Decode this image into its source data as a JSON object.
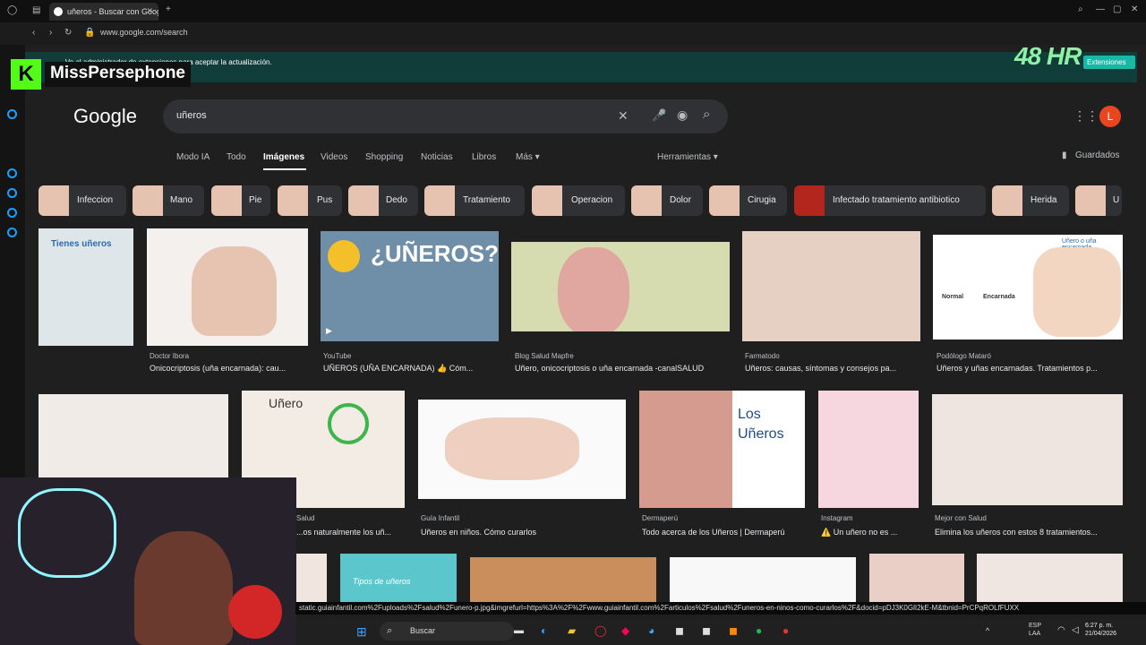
{
  "browser": {
    "tab_title": "uñeros - Buscar con Google",
    "url": "www.google.com/search",
    "notice": "...  Ve al administrador de extensiones para aceptar la actualización.",
    "extensions_btn": "Extensiones",
    "status_url": "static.guiainfantil.com%2Fuploads%2Fsalud%2Funero-p.jpg&imgrefurl=https%3A%2F%2Fwww.guiainfantil.com%2Farticulos%2Fsalud%2Funeros-en-ninos-como-curarlos%2F&docid=pDJ3K0GlI2kE-M&tbnid=PrCPqROLfFUXX"
  },
  "overlay": {
    "streamer": "MissPersephone",
    "badge": "48 HR",
    "kick_logo": "K"
  },
  "google": {
    "logo": "Google",
    "query": "uñeros",
    "avatar": "L",
    "nav": [
      "Modo IA",
      "Todo",
      "Imágenes",
      "Videos",
      "Shopping",
      "Noticias",
      "Libros",
      "Más ▾"
    ],
    "tools": "Herramientas ▾",
    "saved": "Guardados",
    "chips": [
      "Infeccion",
      "Mano",
      "Pie",
      "Pus",
      "Dedo",
      "Tratamiento",
      "Operacion",
      "Dolor",
      "Cirugia",
      "Infectado tratamiento antibiotico",
      "Herida",
      "U"
    ]
  },
  "results_row1": [
    {
      "source": "Doctor Ibora",
      "caption": "Onicocriptosis (uña encarnada): cau..."
    },
    {
      "source": "YouTube",
      "caption": "UÑEROS (UÑA ENCARNADA) 👍 Cóm..."
    },
    {
      "source": "Blog Salud Mapfre",
      "caption": "Uñero, onicocriptosis o uña encarnada -canalSALUD"
    },
    {
      "source": "Farmatodo",
      "caption": "Uñeros: causas, síntomas y consejos pa..."
    },
    {
      "source": "Podólogo Mataró",
      "caption": "Uñeros y uñas encarnadas. Tratamientos p..."
    }
  ],
  "results_row2": [
    {
      "source": "Salud",
      "caption": "...os naturalmente los uñ..."
    },
    {
      "source": "Guía Infantil",
      "caption": "Uñeros en niños. Cómo curarlos"
    },
    {
      "source": "Dermaperú",
      "caption": "Todo acerca de los Uñeros | Dermaperú"
    },
    {
      "source": "Instagram",
      "caption": "⚠️ Un uñero no es ..."
    },
    {
      "source": "Mejor con Salud",
      "caption": "Elimina los uñeros con estos 8 tratamientos..."
    }
  ],
  "image_text": {
    "tienes": "Tienes uñeros",
    "uneros_banner": "¿UÑEROS?",
    "diagram_title": "Uñero o uña encarnada",
    "normal": "Normal",
    "encarnada": "Encarnada",
    "unero_label": "Uñero",
    "los_uneros": "Los Uñeros",
    "tipos": "Tipos de uñeros"
  },
  "taskbar": {
    "search": "Buscar",
    "lang": "ESP LAA",
    "time": "6:27 p. m.",
    "date": "21/04/2026"
  }
}
